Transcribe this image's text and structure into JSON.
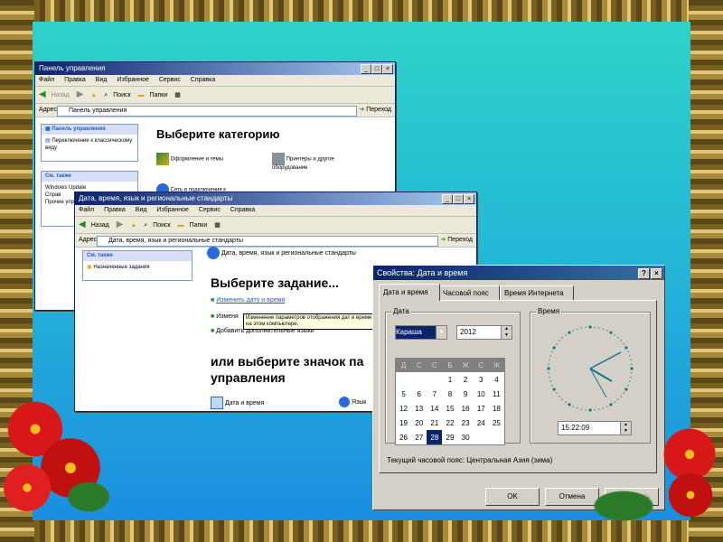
{
  "cp_window": {
    "title": "Панель управления",
    "menu": [
      "Файл",
      "Правка",
      "Вид",
      "Избранное",
      "Сервис",
      "Справка"
    ],
    "toolbar": {
      "back": "Назад",
      "search": "Поиск",
      "folders": "Папки"
    },
    "address_label": "Адрес:",
    "address_value": "Панель управления",
    "go_label": "Переход",
    "panel1_title": "Панель управления",
    "switch_view": "Переключение к классическому виду",
    "see_also_title": "См. также",
    "see_also_items": [
      "Windows Update",
      "Справ",
      "Прочие управле"
    ],
    "heading": "Выберите категорию",
    "categories": [
      "Оформление и темы",
      "Принтеры и другое оборудование",
      "Сеть и подключения к"
    ]
  },
  "dt_window": {
    "title": "Дата, время, язык и региональные стандарты",
    "menu": [
      "Файл",
      "Правка",
      "Вид",
      "Избранное",
      "Сервис",
      "Справка"
    ],
    "toolbar": {
      "back": "Назад",
      "search": "Поиск",
      "folders": "Папки"
    },
    "address_label": "Адрес:",
    "address_value": "Дата, время, язык и региональные стандарты",
    "go_label": "Переход",
    "see_also_title": "См. также",
    "see_also_item": "Назначенные задания",
    "category_title": "Дата, время, язык и региональные стандарты",
    "task_heading": "Выберите задание...",
    "tasks": [
      "Изменить дату и время",
      "Изменя",
      "Добавить дополнительные языки"
    ],
    "tooltip": "Изменение параметров отображения дат и време на этом компьютере.",
    "icon_heading": "или выберите значок па управления",
    "icons": [
      "Дата и время",
      "Язык"
    ]
  },
  "dialog": {
    "title": "Свойства: Дата и время",
    "tabs": [
      "Дата и время",
      "Часовой пояс",
      "Время Интернета"
    ],
    "date_group": "Дата",
    "time_group": "Время",
    "month": "Караша",
    "year": "2012",
    "weekdays": [
      "Д",
      "С",
      "С",
      "Б",
      "Ж",
      "С",
      "Ж"
    ],
    "weeks": [
      [
        "",
        "",
        "",
        "1",
        "2",
        "3",
        "4"
      ],
      [
        "5",
        "6",
        "7",
        "8",
        "9",
        "10",
        "11"
      ],
      [
        "12",
        "13",
        "14",
        "15",
        "16",
        "17",
        "18"
      ],
      [
        "19",
        "20",
        "21",
        "22",
        "23",
        "24",
        "25"
      ],
      [
        "26",
        "27",
        "28",
        "29",
        "30",
        "",
        ""
      ]
    ],
    "selected_day": "28",
    "time": "15:22:09",
    "timezone": "Текущий часовой пояс: Центральная Азия (зима)",
    "ok": "OK",
    "cancel": "Отмена",
    "apply": "Применить"
  },
  "colors": {
    "accent": "#0a246a",
    "stage_top": "#2fd2c8",
    "stage_bottom": "#1c8ee0"
  }
}
